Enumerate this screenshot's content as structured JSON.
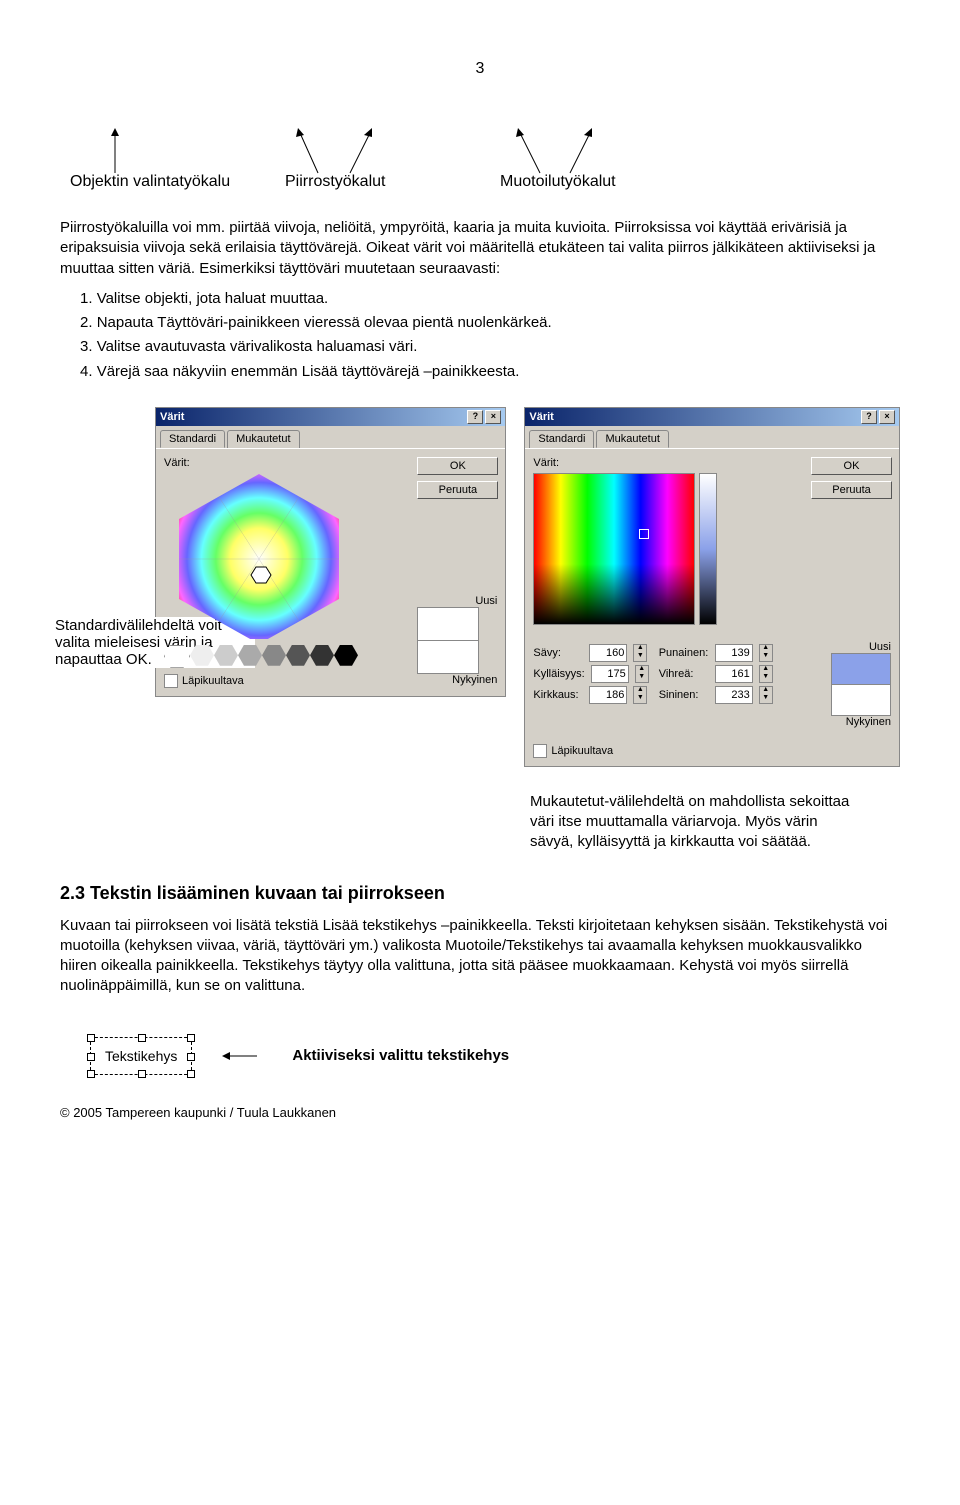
{
  "page_number": "3",
  "tool_labels": {
    "selection": "Objektin valintatyökalu",
    "drawing": "Piirrostyökalut",
    "formatting": "Muotoilutyökalut"
  },
  "paragraph1": "Piirrostyökaluilla voi mm. piirtää viivoja, neliöitä, ympyröitä, kaaria ja muita kuvioita. Piirroksissa voi käyttää erivärisiä ja eripaksuisia viivoja sekä erilaisia täyttövärejä. Oikeat värit voi määritellä etukäteen tai valita piirros jälkikäteen aktiiviseksi ja muuttaa sitten väriä. Esimerkiksi täyttöväri muutetaan seuraavasti:",
  "steps": [
    "Valitse objekti, jota haluat muuttaa.",
    "Napauta Täyttöväri-painikkeen vieressä olevaa pientä nuolenkärkeä.",
    "Valitse avautuvasta värivalikosta haluamasi väri.",
    "Värejä saa näkyviin enemmän Lisää täyttövärejä –painikkeesta."
  ],
  "dialog": {
    "title": "Värit",
    "tabs": {
      "standard": "Standardi",
      "custom": "Mukautetut"
    },
    "labels": {
      "colors": "Värit:",
      "ok": "OK",
      "cancel": "Peruuta",
      "new": "Uusi",
      "current": "Nykyinen",
      "transparent": "Läpikuultava",
      "hue": "Sävy:",
      "sat": "Kylläisyys:",
      "lum": "Kirkkaus:",
      "red": "Punainen:",
      "green": "Vihreä:",
      "blue": "Sininen:"
    },
    "values": {
      "hue": "160",
      "sat": "175",
      "lum": "186",
      "red": "139",
      "green": "161",
      "blue": "233"
    }
  },
  "callout_standard": "Standardivälilehdeltä voit valita mieleisesi värin ja napauttaa OK.",
  "callout_custom": "Mukautetut-välilehdeltä on mahdollista sekoittaa väri itse muuttamalla väriarvoja. Myös värin sävyä, kylläisyyttä ja kirkkautta voi säätää.",
  "section_2_3_title": "2.3 Tekstin lisääminen kuvaan tai piirrokseen",
  "section_2_3_body": "Kuvaan tai piirrokseen voi lisätä tekstiä Lisää tekstikehys –painikkeella. Teksti kirjoitetaan kehyksen sisään. Tekstikehystä voi muotoilla (kehyksen viivaa, väriä, täyttöväri ym.) valikosta Muotoile/Tekstikehys tai avaamalla kehyksen muokkausvalikko hiiren oikealla painikkeella. Tekstikehys täytyy olla valittuna, jotta sitä pääsee muokkaamaan. Kehystä voi myös siirrellä nuolinäppäimillä, kun se on valittuna.",
  "textframe_sample": "Tekstikehys",
  "textframe_callout": "Aktiiviseksi valittu tekstikehys",
  "footer": "© 2005 Tampereen kaupunki / Tuula Laukkanen"
}
